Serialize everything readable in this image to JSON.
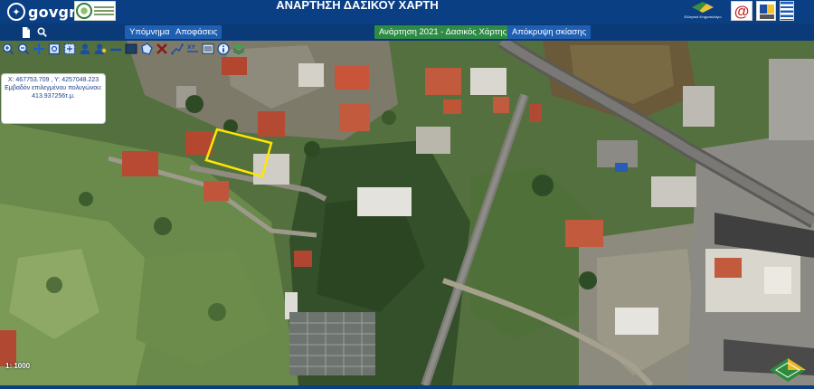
{
  "header": {
    "brand": "govgr",
    "title": "ΑΝΑΡΤΗΣΗ ΔΑΣΙΚΟΥ ΧΑΡΤΗ",
    "ktima_caption": "Ελληνικό Κτηματολόγιο",
    "at_logo": "@"
  },
  "nav": {
    "legend_label": "Υπόμνημα",
    "decisions_label": "Αποφάσεις",
    "map_select_label": "Ανάρτηση 2021 - Δασικός Χάρτης",
    "hide_shading_label": "Απόκρυψη σκίασης"
  },
  "info": {
    "coords": "X: 467753.709 , Y: 4257048.223",
    "area_label": "Εμβαδόν επιλεγμένου πολυγώνου:",
    "area_value": "413.937256τ.μ."
  },
  "map": {
    "scale": "1: 1000"
  },
  "toolbar_icons": [
    "zoom-in-icon",
    "zoom-out-icon",
    "pan-icon",
    "zoom-extent-icon",
    "zoom-selection-icon",
    "identify-user-icon",
    "user-pin-icon",
    "measure-line-icon",
    "measure-area-icon",
    "polygon-select-icon",
    "clear-x-icon",
    "draw-line-icon",
    "xy-coordinates-icon",
    "print-icon",
    "info-icon",
    "layers-icon"
  ],
  "colors": {
    "header_bg": "#0a3f84",
    "nav_button": "#1f5fb3",
    "nav_button_active": "#2e8b46",
    "parcel_outline": "#ffe600"
  }
}
